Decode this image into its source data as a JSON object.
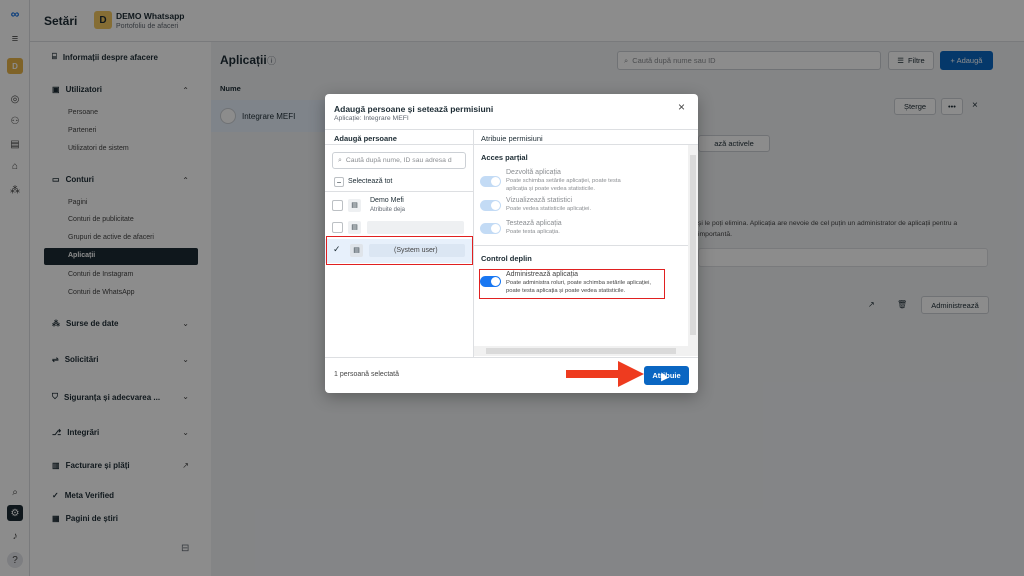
{
  "header": {
    "settings_title": "Setări",
    "account_initial": "D",
    "account_name": "DEMO Whatsapp",
    "account_sub": "Portofoliu de afaceri"
  },
  "sidebar": {
    "business_info": "Informații despre afacere",
    "users": "Utilizatori",
    "users_items": [
      "Persoane",
      "Parteneri",
      "Utilizatori de sistem"
    ],
    "accounts": "Conturi",
    "accounts_items": [
      "Pagini",
      "Conturi de publicitate",
      "Grupuri de active de afaceri",
      "Aplicații",
      "Conturi de Instagram",
      "Conturi de WhatsApp"
    ],
    "data_sources": "Surse de date",
    "requests": "Solicitări",
    "safety": "Siguranța și adecvarea ...",
    "integrations": "Integrări",
    "billing": "Facturare și plăți",
    "meta_verified": "Meta Verified",
    "news_pages": "Pagini de știri"
  },
  "main": {
    "title": "Aplicații",
    "search_placeholder": "Caută după nume sau ID",
    "filter_label": "Filtre",
    "add_label": "+ Adaugă",
    "col_name": "Nume",
    "app_row": "Integrare MEFI",
    "delete_label": "Șterge",
    "more_label": "•••",
    "assets_label": "ază activele",
    "info_text_1": "și le poți elimina. Aplicația are nevoie de cel puțin un administrator de aplicații pentru a",
    "info_text_2": "importantă.",
    "manage_label": "Administrează"
  },
  "modal": {
    "title": "Adaugă persoane și setează permisiuni",
    "subtitle": "Aplicație: Integrare MEFI",
    "left_header": "Adaugă persoane",
    "right_header": "Atribuie permisiuni",
    "search_placeholder": "Caută după nume, ID sau adresa d",
    "select_all": "Selectează tot",
    "people": [
      {
        "name": "Demo Mefi",
        "sub": "Atribuite deja"
      },
      {
        "name": "",
        "sub": ""
      },
      {
        "name": "(System user)",
        "sub": ""
      }
    ],
    "partial_header": "Acces parțial",
    "partial": [
      {
        "title": "Dezvoltă aplicația",
        "desc": "Poate schimba setările aplicației, poate testa aplicația și poate vedea statisticile."
      },
      {
        "title": "Vizualizează statistici",
        "desc": "Poate vedea statisticile aplicației."
      },
      {
        "title": "Testează aplicația",
        "desc": "Poate testa aplicația."
      }
    ],
    "full_header": "Control deplin",
    "full": {
      "title": "Administrează aplicația",
      "desc": "Poate administra roluri, poate schimba setările aplicației, poate testa aplicația și poate vedea statisticile."
    },
    "selected_count": "1 persoană selectată",
    "assign_label": "Atribuie",
    "close_label": "×"
  },
  "colors": {
    "primary": "#0a66c2",
    "highlight": "#e02020",
    "arrow": "#ee3b1f"
  }
}
